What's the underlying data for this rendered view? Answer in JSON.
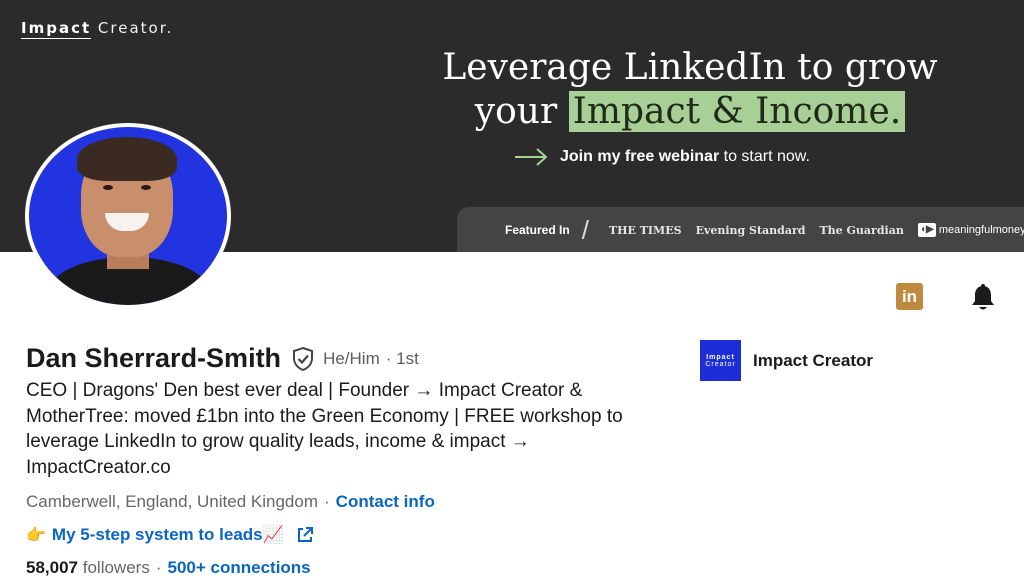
{
  "banner": {
    "brand_part1": "Impact",
    "brand_part2": " Creator.",
    "headline_line1": "Leverage LinkedIn to grow",
    "headline_line2_pre": "your ",
    "headline_line2_highlight": "Impact & Income.",
    "cta_bold": "Join my free webinar",
    "cta_rest": " to start now.",
    "featured_label": "Featured In",
    "publications": [
      "THE TIMES",
      "Evening Standard",
      "The Guardian",
      "meaningfulmoney"
    ],
    "highlight_color": "#a8cf96"
  },
  "actions": {
    "linkedin_icon_text": "in",
    "linkedin_icon": "linkedin-icon",
    "bell_icon": "bell-icon"
  },
  "profile": {
    "name": "Dan Sherrard-Smith",
    "pronouns": "He/Him",
    "degree": "· 1st",
    "headline": "CEO | Dragons' Den best ever deal | Founder → Impact Creator & MotherTree: moved £1bn into the Green Economy | FREE workshop to leverage LinkedIn to grow quality leads, income & impact → ImpactCreator.co",
    "location": "Camberwell, England, United Kingdom",
    "location_sep": "·",
    "contact_info": "Contact info",
    "website_prefix": "👉",
    "website_label": "My 5-step system to leads📈",
    "followers_count": "58,007",
    "followers_label": "followers",
    "connections_sep": "·",
    "connections": "500+ connections"
  },
  "company": {
    "logo_line1": "Impact",
    "logo_line2": "Creator",
    "name": "Impact Creator"
  }
}
